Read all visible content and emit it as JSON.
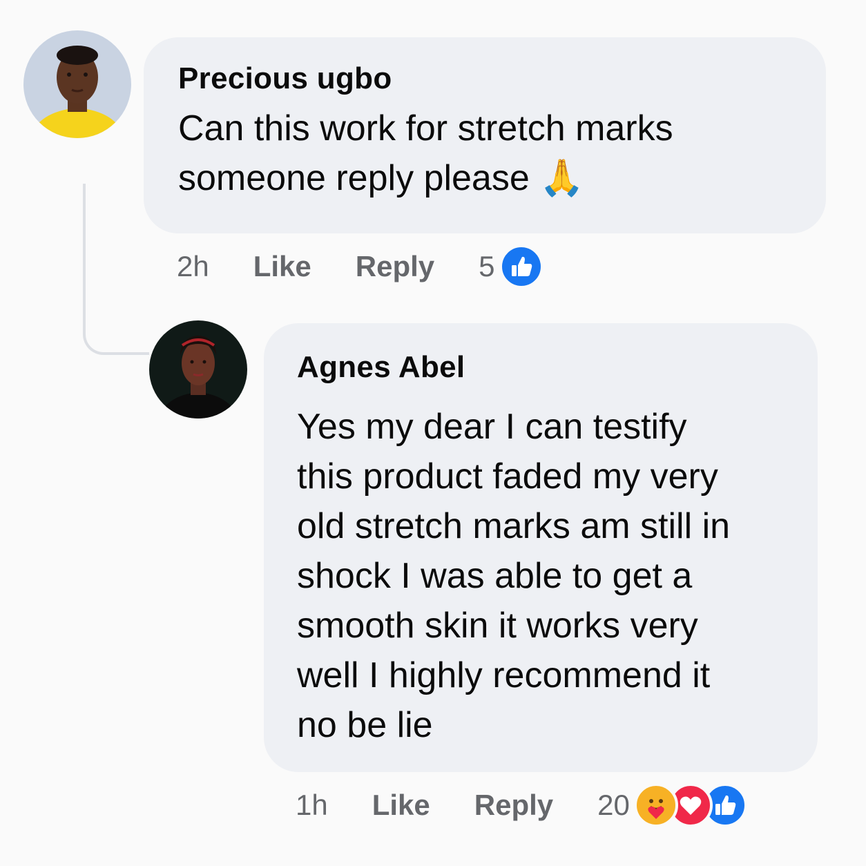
{
  "comments": [
    {
      "author": "Precious ugbo",
      "text_lines": [
        "Can this work for stretch marks",
        "someone reply please"
      ],
      "emoji": "🙏",
      "time": "2h",
      "like_label": "Like",
      "reply_label": "Reply",
      "reaction_count": "5",
      "reactions": [
        "like-reaction-icon"
      ]
    },
    {
      "author": "Agnes Abel",
      "text_lines": [
        "Yes my dear I can testify",
        "this product faded my very",
        "old stretch marks am still in",
        "shock I was able to get a",
        "smooth skin it works very",
        "well I highly recommend it",
        "no be lie"
      ],
      "time": "1h",
      "like_label": "Like",
      "reply_label": "Reply",
      "reaction_count": "20",
      "reactions": [
        "care-reaction-icon",
        "love-reaction-icon",
        "like-reaction-icon"
      ]
    }
  ],
  "colors": {
    "like_blue": "#1877f2",
    "love_red": "#f02849",
    "care_yellow": "#f7b125",
    "bubble_bg": "#eef0f4",
    "meta_gray": "#65676b"
  }
}
